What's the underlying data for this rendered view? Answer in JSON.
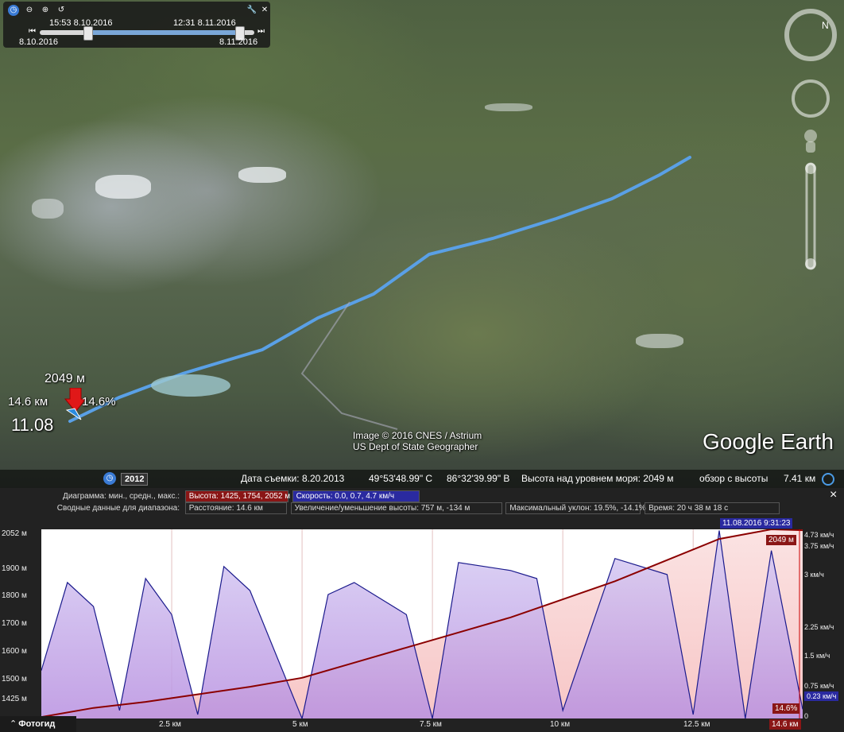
{
  "time_widget": {
    "start_label": "15:53 8.10.2016",
    "end_label": "12:31 8.11.2016",
    "left_date": "8.10.2016",
    "right_date": "8.11.2016"
  },
  "map": {
    "altitude_marker": "2049 м",
    "distance_marker": "14.6 км",
    "slope_marker": "14.6%",
    "speed_marker": "11.08",
    "copyright_1": "Image © 2016 CNES / Astrium",
    "copyright_2": "US Dept of State Geographer",
    "logo": "Google Earth"
  },
  "status_bar": {
    "year_badge": "2012",
    "capture_date": "Дата съемки: 8.20.2013",
    "lat": "49°53'48.99\" С",
    "lon": "86°32'39.99\" В",
    "elevation": "Высота над уровнем моря:  2049 м",
    "eye_alt_label": "обзор с высоты",
    "eye_alt_value": "7.41 км"
  },
  "profile": {
    "diagram_label": "Диаграмма: мин., средн., макс.:",
    "height_stat": "Высота: 1425, 1754, 2052 м",
    "speed_stat": "Скорость: 0.0, 0.7, 4.7 км/ч",
    "summary_label": "Сводные данные для диапазона:",
    "distance_stat": "Расстояние: 14.6 км",
    "gain_stat": "Увеличение/уменьшение высоты: 757 м, -134 м",
    "slope_stat": "Максимальный уклон: 19.5%, -14.1%",
    "time_stat": "Время: 20 ч 38 м 18 с",
    "close": "×",
    "cursor_time": "11.08.2016 9:31:23",
    "cursor_elev": "2049 м",
    "cursor_slope": "14.6%",
    "cursor_dist": "14.6 км",
    "speed_now": "0.23 км/ч",
    "photo_button": "Фотогид",
    "y_left": [
      "2052 м",
      "1900 м",
      "1800 м",
      "1700 м",
      "1600 м",
      "1500 м",
      "1425 м"
    ],
    "y_right": [
      "4.73 км/ч",
      "3.75 км/ч",
      "3 км/ч",
      "2.25 км/ч",
      "1.5 км/ч",
      "0.75 км/ч",
      "0"
    ],
    "x_ticks": [
      "2.5 км",
      "5 км",
      "7.5 км",
      "10 км",
      "12.5 км"
    ]
  },
  "chart_data": {
    "type": "line",
    "x_unit": "км",
    "series": [
      {
        "name": "Высота",
        "color": "#8b0000",
        "x": [
          0,
          1,
          2,
          3,
          4,
          5,
          6,
          7,
          8,
          9,
          10,
          11,
          12,
          13,
          14,
          14.6
        ],
        "y": [
          1430,
          1460,
          1480,
          1505,
          1530,
          1560,
          1610,
          1660,
          1710,
          1760,
          1820,
          1880,
          1950,
          2020,
          2052,
          2049
        ]
      },
      {
        "name": "Скорость",
        "color": "#1a1a8c",
        "x": [
          0,
          0.5,
          1,
          1.5,
          2,
          2.5,
          3,
          3.5,
          4,
          5,
          5.5,
          6,
          7,
          7.5,
          8,
          9,
          9.5,
          10,
          11,
          12,
          12.5,
          13,
          13.5,
          14,
          14.6
        ],
        "y": [
          1.2,
          3.4,
          2.8,
          0.2,
          3.5,
          2.6,
          0.1,
          3.8,
          3.2,
          0.0,
          3.1,
          3.4,
          2.6,
          0.0,
          3.9,
          3.7,
          3.5,
          0.2,
          4.0,
          3.6,
          0.1,
          4.7,
          0.0,
          4.2,
          0.23
        ]
      }
    ],
    "ylim_left": [
      1425,
      2052
    ],
    "ylim_right": [
      0,
      4.73
    ],
    "xlim": [
      0,
      14.6
    ]
  }
}
